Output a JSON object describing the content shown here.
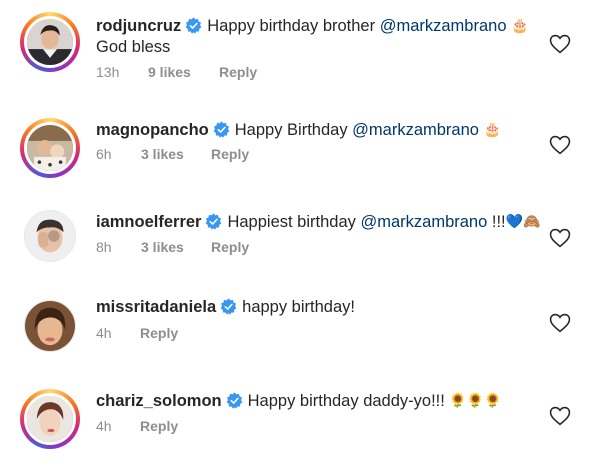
{
  "comments": [
    {
      "username": "rodjuncruz",
      "text": "Happy birthday brother",
      "mention": "@markzambrano",
      "emoji": "🎂",
      "text2": "God bless",
      "time": "13h",
      "likes": "9 likes",
      "reply": "Reply"
    },
    {
      "username": "magnopancho",
      "text": "Happy Birthday",
      "mention": "@markzambrano",
      "emoji": "🎂",
      "time": "6h",
      "likes": "3 likes",
      "reply": "Reply"
    },
    {
      "username": "iamnoelferrer",
      "text": "Happiest birthday",
      "mention": "@markzambrano",
      "trailing": "!!!",
      "emoji": "💙🙈",
      "time": "8h",
      "likes": "3 likes",
      "reply": "Reply"
    },
    {
      "username": "missritadaniela",
      "text": "happy birthday!",
      "time": "4h",
      "reply": "Reply"
    },
    {
      "username": "chariz_solomon",
      "text": "Happy birthday daddy-yo!!!",
      "emoji": "🌻🌻🌻",
      "time": "4h",
      "reply": "Reply"
    }
  ],
  "icons": {
    "verified": "verified-badge-icon",
    "like": "heart-outline-icon"
  },
  "colors": {
    "verified_blue": "#3897f0",
    "mention": "#00376b",
    "meta": "#8e8e8e"
  }
}
